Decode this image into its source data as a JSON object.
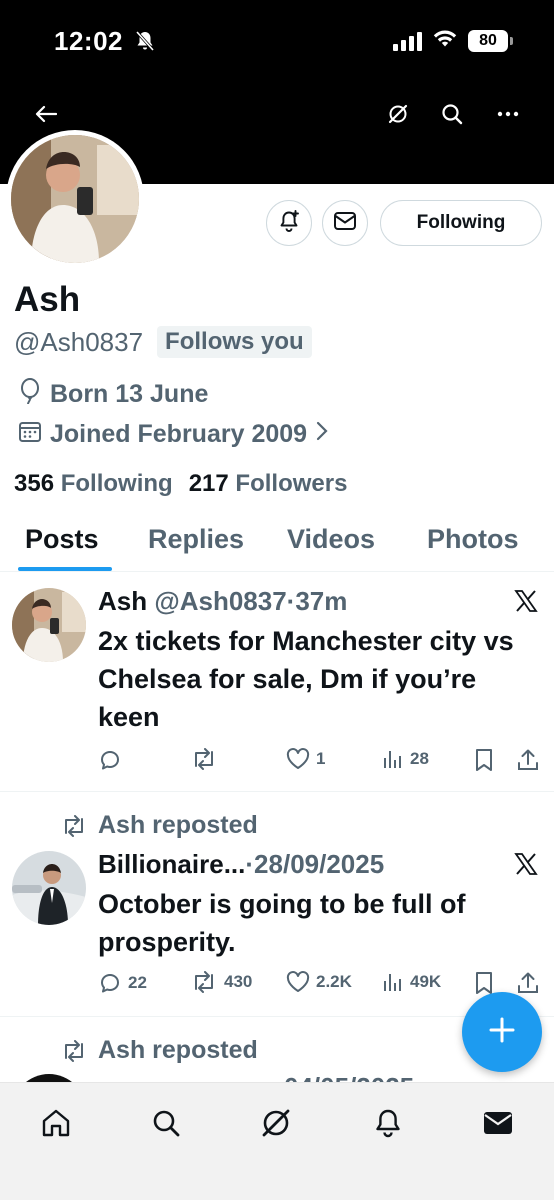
{
  "status": {
    "time": "12:02",
    "battery": "80"
  },
  "profile": {
    "name": "Ash",
    "handle": "@Ash0837",
    "follows_you": "Follows you",
    "born": "Born 13 June",
    "joined": "Joined February 2009",
    "following_count": "356",
    "following_label": "Following",
    "followers_count": "217",
    "followers_label": "Followers",
    "following_button": "Following"
  },
  "tabs": [
    {
      "label": "Posts"
    },
    {
      "label": "Replies"
    },
    {
      "label": "Videos"
    },
    {
      "label": "Photos"
    }
  ],
  "posts": [
    {
      "name": "Ash",
      "handle": "@Ash0837",
      "time": "37m",
      "text": "2x tickets for Manchester city vs Chelsea for sale, Dm if you’re keen",
      "replies": "",
      "reposts": "",
      "likes": "1",
      "views": "28"
    },
    {
      "repost_label": "Ash reposted",
      "name": "Billionaire...",
      "date": "28/09/2025",
      "text": "October is going to be full of prosperity.",
      "replies": "22",
      "reposts": "430",
      "likes": "2.2K",
      "views": "49K"
    },
    {
      "repost_label": "Ash reposted",
      "date": "04/05/2025"
    }
  ],
  "colors": {
    "accent": "#1d9bf0",
    "text": "#0f1419",
    "muted": "#536471"
  }
}
